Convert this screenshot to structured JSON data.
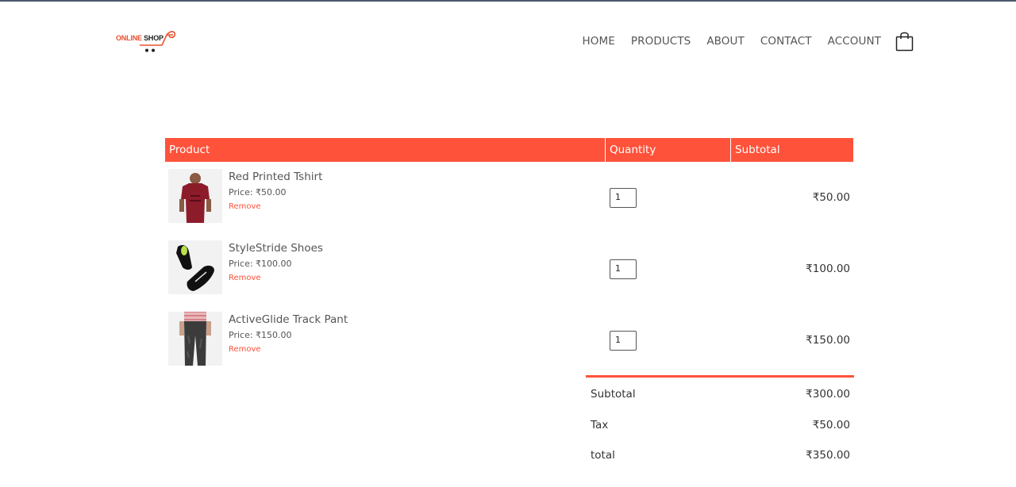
{
  "header": {
    "logo_text_1": "ONLINE",
    "logo_text_2": "SHOP",
    "nav": [
      "HOME",
      "PRODUCTS",
      "ABOUT",
      "CONTACT",
      "ACCOUNT"
    ],
    "cart_icon": "shopping-bag-icon"
  },
  "table": {
    "headers": {
      "product": "Product",
      "quantity": "Quantity",
      "subtotal": "Subtotal"
    },
    "items": [
      {
        "name": "Red Printed Tshirt",
        "price": "Price: ₹50.00",
        "remove": "Remove",
        "qty": "1",
        "subtotal": "₹50.00"
      },
      {
        "name": "StyleStride Shoes",
        "price": "Price: ₹100.00",
        "remove": "Remove",
        "qty": "1",
        "subtotal": "₹100.00"
      },
      {
        "name": "ActiveGlide Track Pant",
        "price": "Price: ₹150.00",
        "remove": "Remove",
        "qty": "1",
        "subtotal": "₹150.00"
      }
    ]
  },
  "totals": {
    "subtotal_label": "Subtotal",
    "subtotal_value": "₹300.00",
    "tax_label": "Tax",
    "tax_value": "₹50.00",
    "total_label": "total",
    "total_value": "₹350.00"
  },
  "colors": {
    "accent": "#ff523b",
    "text": "#555555"
  }
}
